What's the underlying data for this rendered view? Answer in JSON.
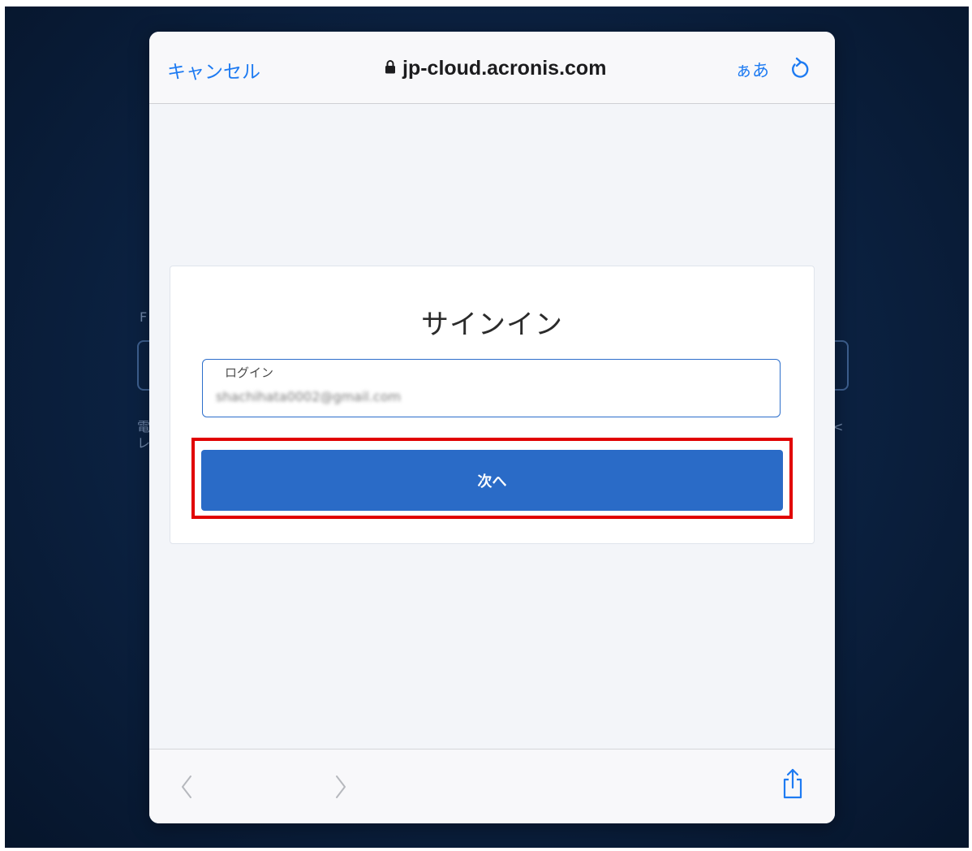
{
  "background_page": {
    "fragments": [
      "F",
      "電",
      "レ",
      "<"
    ]
  },
  "browser": {
    "cancel_label": "キャンセル",
    "url": "jp-cloud.acronis.com",
    "text_size_label": "ぁあ",
    "icons": [
      "lock-icon",
      "reload-icon",
      "back-arrow-icon",
      "forward-arrow-icon",
      "share-icon"
    ]
  },
  "signin": {
    "title": "サインイン",
    "login_label": "ログイン",
    "login_value": "shachihata0002@gmail.com",
    "next_label": "次へ"
  },
  "colors": {
    "accent_blue": "#1e7bf2",
    "button_blue": "#2a6bc7",
    "highlight_red": "#e10000"
  }
}
